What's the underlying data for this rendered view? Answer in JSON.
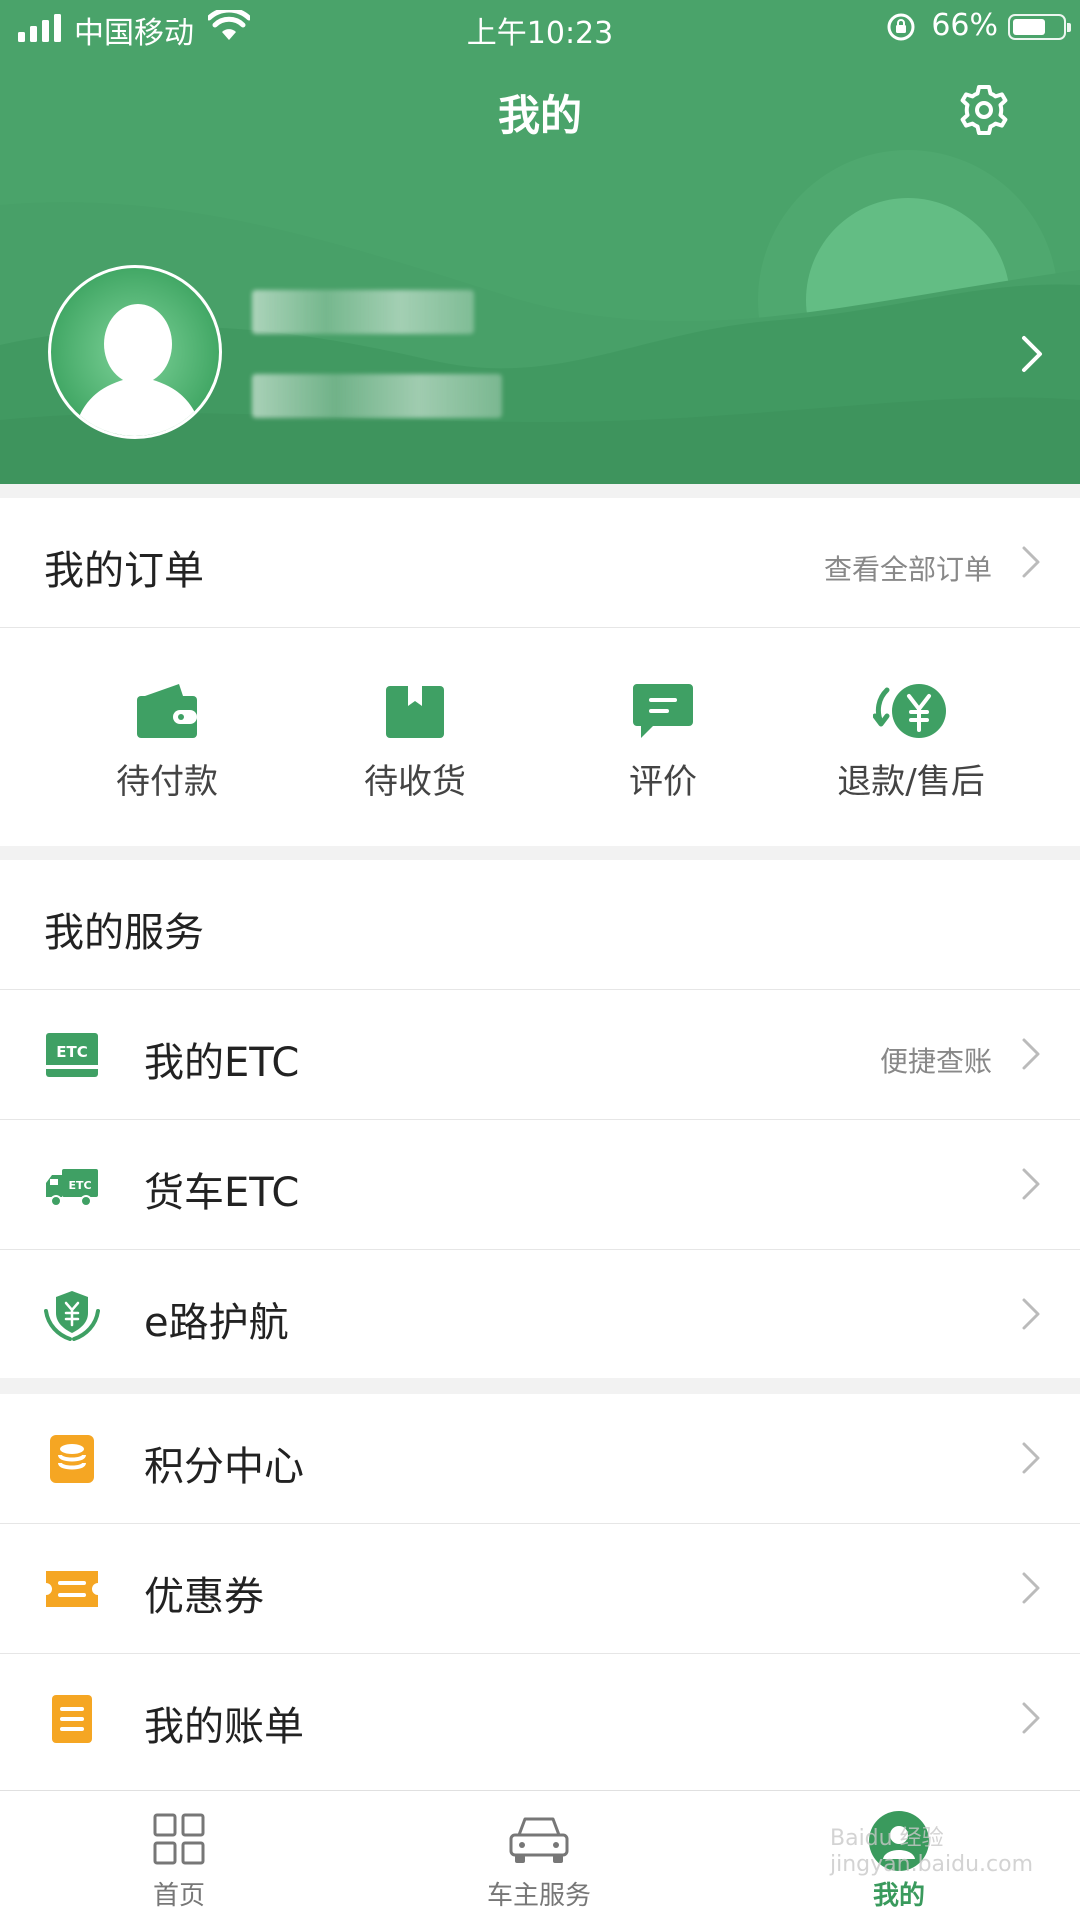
{
  "status_bar": {
    "carrier": "中国移动",
    "time": "上午10:23",
    "battery": "66%",
    "battery_level": 0.66
  },
  "header": {
    "title": "我的"
  },
  "orders": {
    "title": "我的订单",
    "view_all": "查看全部订单",
    "items": [
      {
        "label": "待付款",
        "icon": "wallet-icon"
      },
      {
        "label": "待收货",
        "icon": "package-icon"
      },
      {
        "label": "评价",
        "icon": "comment-icon"
      },
      {
        "label": "退款/售后",
        "icon": "refund-icon"
      }
    ]
  },
  "services": {
    "title": "我的服务",
    "items": [
      {
        "label": "我的ETC",
        "note": "便捷查账",
        "icon": "etc-card-icon"
      },
      {
        "label": "货车ETC",
        "note": "",
        "icon": "truck-etc-icon"
      },
      {
        "label": "e路护航",
        "note": "",
        "icon": "shield-hands-icon"
      }
    ]
  },
  "more": {
    "items": [
      {
        "label": "积分中心",
        "icon": "coins-icon"
      },
      {
        "label": "优惠券",
        "icon": "coupon-icon"
      },
      {
        "label": "我的账单",
        "icon": "bill-icon"
      }
    ]
  },
  "tabbar": {
    "items": [
      {
        "label": "首页",
        "icon": "grid-icon"
      },
      {
        "label": "车主服务",
        "icon": "car-icon"
      },
      {
        "label": "我的",
        "icon": "profile-icon",
        "active": true
      }
    ]
  },
  "watermark": "Baidu 经验 jingyan.baidu.com",
  "colors": {
    "brand_green": "#4aa36a",
    "accent_orange": "#f5a623"
  }
}
